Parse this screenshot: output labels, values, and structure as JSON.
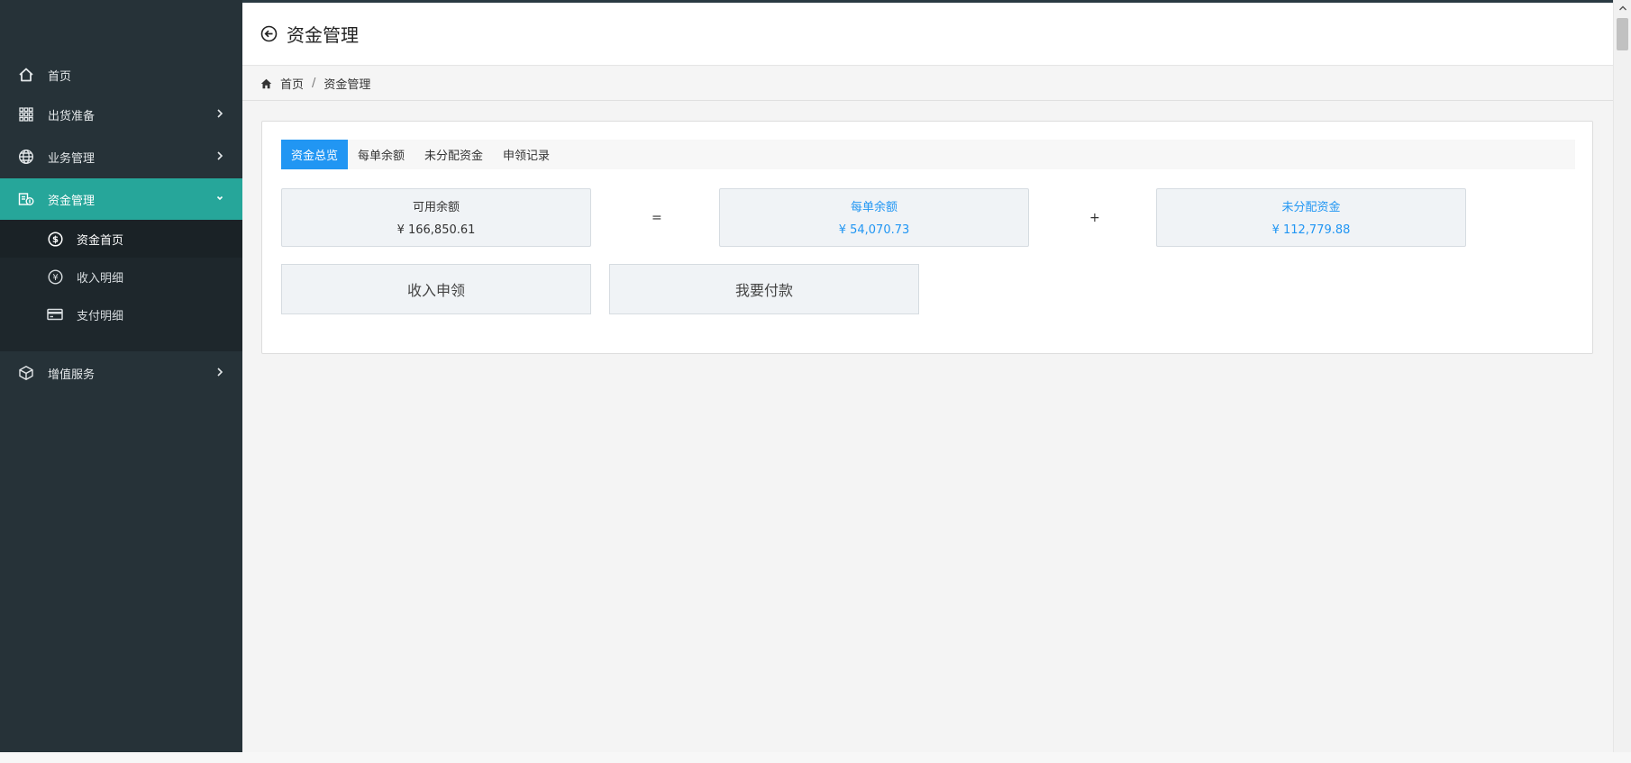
{
  "sidebar": {
    "items": [
      {
        "label": "首页",
        "icon": "home-icon"
      },
      {
        "label": "出货准备",
        "icon": "grid-icon"
      },
      {
        "label": "业务管理",
        "icon": "globe-icon"
      },
      {
        "label": "资金管理",
        "icon": "money-icon"
      },
      {
        "label": "增值服务",
        "icon": "cube-icon"
      }
    ],
    "sub_items": [
      {
        "label": "资金首页",
        "icon": "dollar-circle-icon"
      },
      {
        "label": "收入明细",
        "icon": "yen-circle-icon"
      },
      {
        "label": "支付明细",
        "icon": "credit-card-icon"
      }
    ]
  },
  "header": {
    "title": "资金管理",
    "back_icon": "back-arrow-icon"
  },
  "breadcrumb": {
    "home": "首页",
    "separator": "/",
    "current": "资金管理"
  },
  "tabs": [
    {
      "label": "资金总览"
    },
    {
      "label": "每单余额"
    },
    {
      "label": "未分配资金"
    },
    {
      "label": "申领记录"
    }
  ],
  "stats": {
    "available": {
      "label": "可用余额",
      "value": "¥ 166,850.61"
    },
    "equals": "=",
    "per_order": {
      "label": "每单余额",
      "value": "¥ 54,070.73"
    },
    "plus": "+",
    "unallocated": {
      "label": "未分配资金",
      "value": "¥ 112,779.88"
    }
  },
  "actions": {
    "claim_income": "收入申领",
    "pay": "我要付款"
  },
  "colors": {
    "sidebar": "#263238",
    "active_menu": "#26a69a",
    "accent": "#2196f3"
  }
}
